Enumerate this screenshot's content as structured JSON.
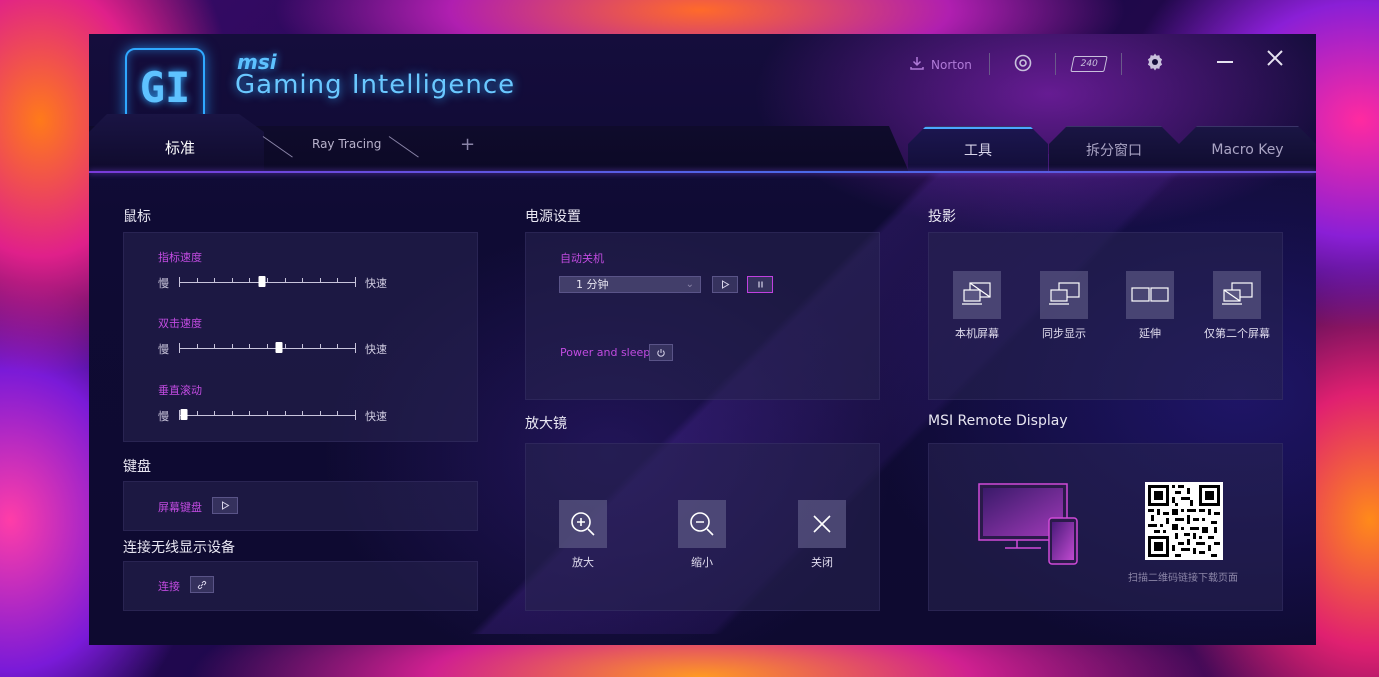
{
  "app": {
    "brand_top": "msi",
    "title": "Gaming Intelligence",
    "logo_text": "GI"
  },
  "top_controls": {
    "norton": "Norton",
    "refresh_rate": "240"
  },
  "profile_tabs": [
    {
      "label": "标准"
    },
    {
      "label": "Ray Tracing"
    },
    {
      "label": "+"
    }
  ],
  "feature_tabs": [
    {
      "label": "工具"
    },
    {
      "label": "拆分窗口"
    },
    {
      "label": "Macro Key"
    }
  ],
  "mouse": {
    "title": "鼠标",
    "sliders": [
      {
        "label": "指标速度",
        "min": "慢",
        "max": "快速",
        "value": 0.47
      },
      {
        "label": "双击速度",
        "min": "慢",
        "max": "快速",
        "value": 0.57
      },
      {
        "label": "垂直滚动",
        "min": "慢",
        "max": "快速",
        "value": 0.03
      }
    ]
  },
  "keyboard": {
    "title": "键盘",
    "onscreen_label": "屏幕键盘"
  },
  "wireless": {
    "title": "连接无线显示设备",
    "connect_label": "连接"
  },
  "power": {
    "title": "电源设置",
    "auto_shutdown_label": "自动关机",
    "selected": "1 分钟",
    "power_sleep_label": "Power and sleep"
  },
  "magnifier": {
    "title": "放大镜",
    "items": [
      {
        "label": "放大"
      },
      {
        "label": "缩小"
      },
      {
        "label": "关闭"
      }
    ]
  },
  "projection": {
    "title": "投影",
    "items": [
      {
        "label": "本机屏幕"
      },
      {
        "label": "同步显示"
      },
      {
        "label": "延伸"
      },
      {
        "label": "仅第二个屏幕"
      }
    ]
  },
  "remote": {
    "title": "MSI Remote Display",
    "qr_caption": "扫描二维码链接下载页面"
  }
}
